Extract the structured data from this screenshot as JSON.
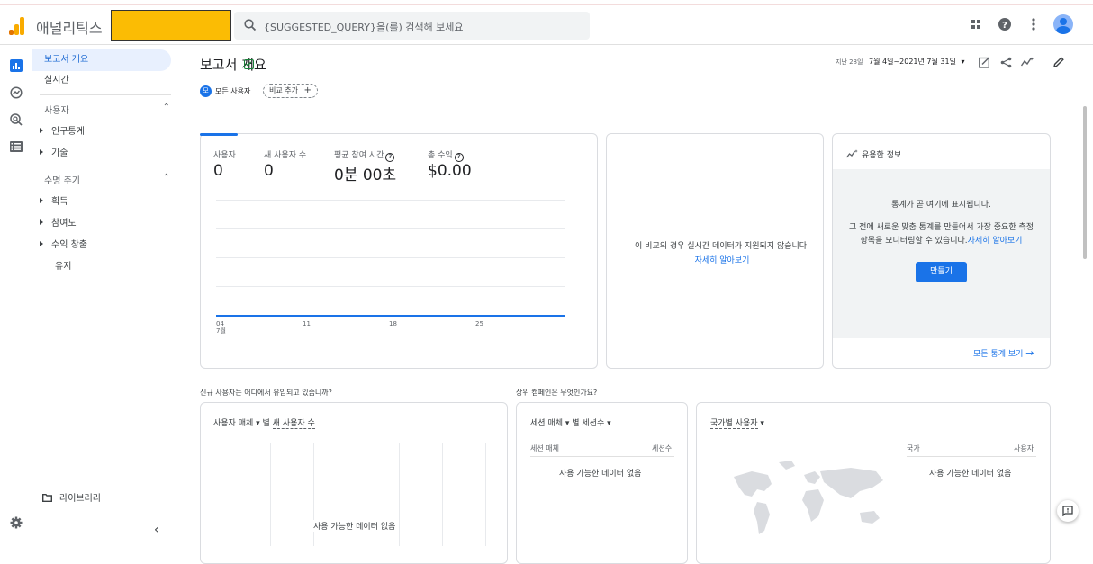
{
  "app": {
    "title": "애널리틱스"
  },
  "search": {
    "placeholder": "{SUGGESTED_QUERY}을(를) 검색해 보세요"
  },
  "sidebar": {
    "overview": "보고서 개요",
    "realtime": "실시간",
    "user_section": "사용자",
    "demographics": "인구통계",
    "tech": "기술",
    "lifecycle_section": "수명 주기",
    "acquisition": "획득",
    "engagement": "참여도",
    "monetization": "수익 창출",
    "retention": "유지",
    "library": "라이브러리"
  },
  "page": {
    "title": "보고서 개요",
    "chip_all_users": "모든 사용자",
    "chip_all_users_initial": "모",
    "chip_add_compare": "비교 추가",
    "date_label": "지난 28일",
    "date_range": "7월 4일~2021년 7월 31일"
  },
  "metrics": [
    {
      "label": "사용자",
      "value": "0"
    },
    {
      "label": "새 사용자 수",
      "value": "0"
    },
    {
      "label": "평균 참여 시간",
      "value": "0분 00초"
    },
    {
      "label": "총 수익",
      "value": "$0.00"
    }
  ],
  "chart_data": {
    "type": "line",
    "x": [
      "04",
      "11",
      "18",
      "25"
    ],
    "x_sublabel": "7월",
    "series": [
      {
        "values": [
          0,
          0,
          0,
          0
        ]
      }
    ],
    "grid": true
  },
  "realtime_card": {
    "message": "이 비교의 경우 실시간 데이터가 지원되지 않습니다.",
    "link": "자세히 알아보기"
  },
  "insights": {
    "title": "유용한 정보",
    "line1": "통계가 곧 여기에 표시됩니다.",
    "line2": "그 전에 새로운 맞춤 통계를 만들어서 가장 중요한 측정",
    "line3": "항목을 모니터링할 수 있습니다.",
    "link": "자세히 알아보기",
    "button": "만들기",
    "all_stats": "모든 통계 보기"
  },
  "section_new_users": "신규 사용자는 어디에서 유입되고 있습니까?",
  "section_campaigns": "상위 캠페인은 무엇인가요?",
  "card_source": {
    "dim": "사용자 매체",
    "by": "별",
    "metric": "새 사용자 수",
    "no_data": "사용 가능한 데이터 없음"
  },
  "card_session": {
    "dim": "세션 매체",
    "by": "별",
    "metric": "세션수",
    "col1": "세션 매체",
    "col2": "세션수",
    "no_data": "사용 가능한 데이터 없음"
  },
  "card_country": {
    "title": "국가별 사용자",
    "col1": "국가",
    "col2": "사용자",
    "no_data": "사용 가능한 데이터 없음"
  },
  "colors": {
    "accent": "#1a73e8",
    "logo_orange": "#f9ab00",
    "logo_dark": "#e37400"
  }
}
